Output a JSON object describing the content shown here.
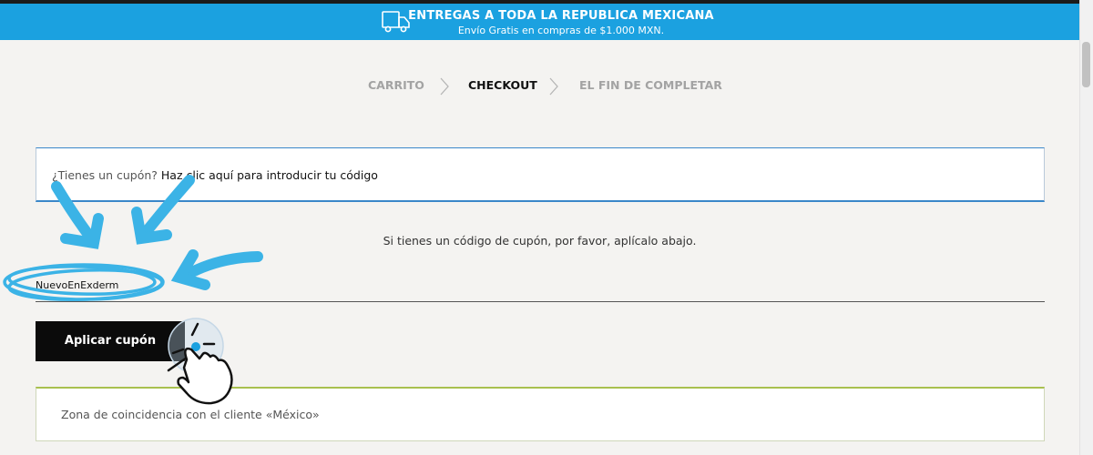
{
  "banner": {
    "title": "ENTREGAS A TODA LA REPUBLICA MEXICANA",
    "subtitle": "Envío Gratis en compras de $1.000 MXN.",
    "icon": "truck-icon"
  },
  "breadcrumbs": {
    "step1": "CARRITO",
    "step2": "CHECKOUT",
    "step3": "EL FIN DE COMPLETAR"
  },
  "coupon_notice": {
    "question": "¿Tienes un cupón?",
    "link": "Haz clic aquí para introducir tu código"
  },
  "coupon_form": {
    "info": "Si tienes un código de cupón, por favor, aplícalo abajo.",
    "value": "NuevoEnExderm",
    "apply_label": "Aplicar cupón"
  },
  "zone_notice": {
    "text": "Zona de coincidencia con el cliente «México»"
  },
  "colors": {
    "banner": "#1ba1e0",
    "annotation": "#3bb3e6",
    "button": "#0b0b0b"
  }
}
